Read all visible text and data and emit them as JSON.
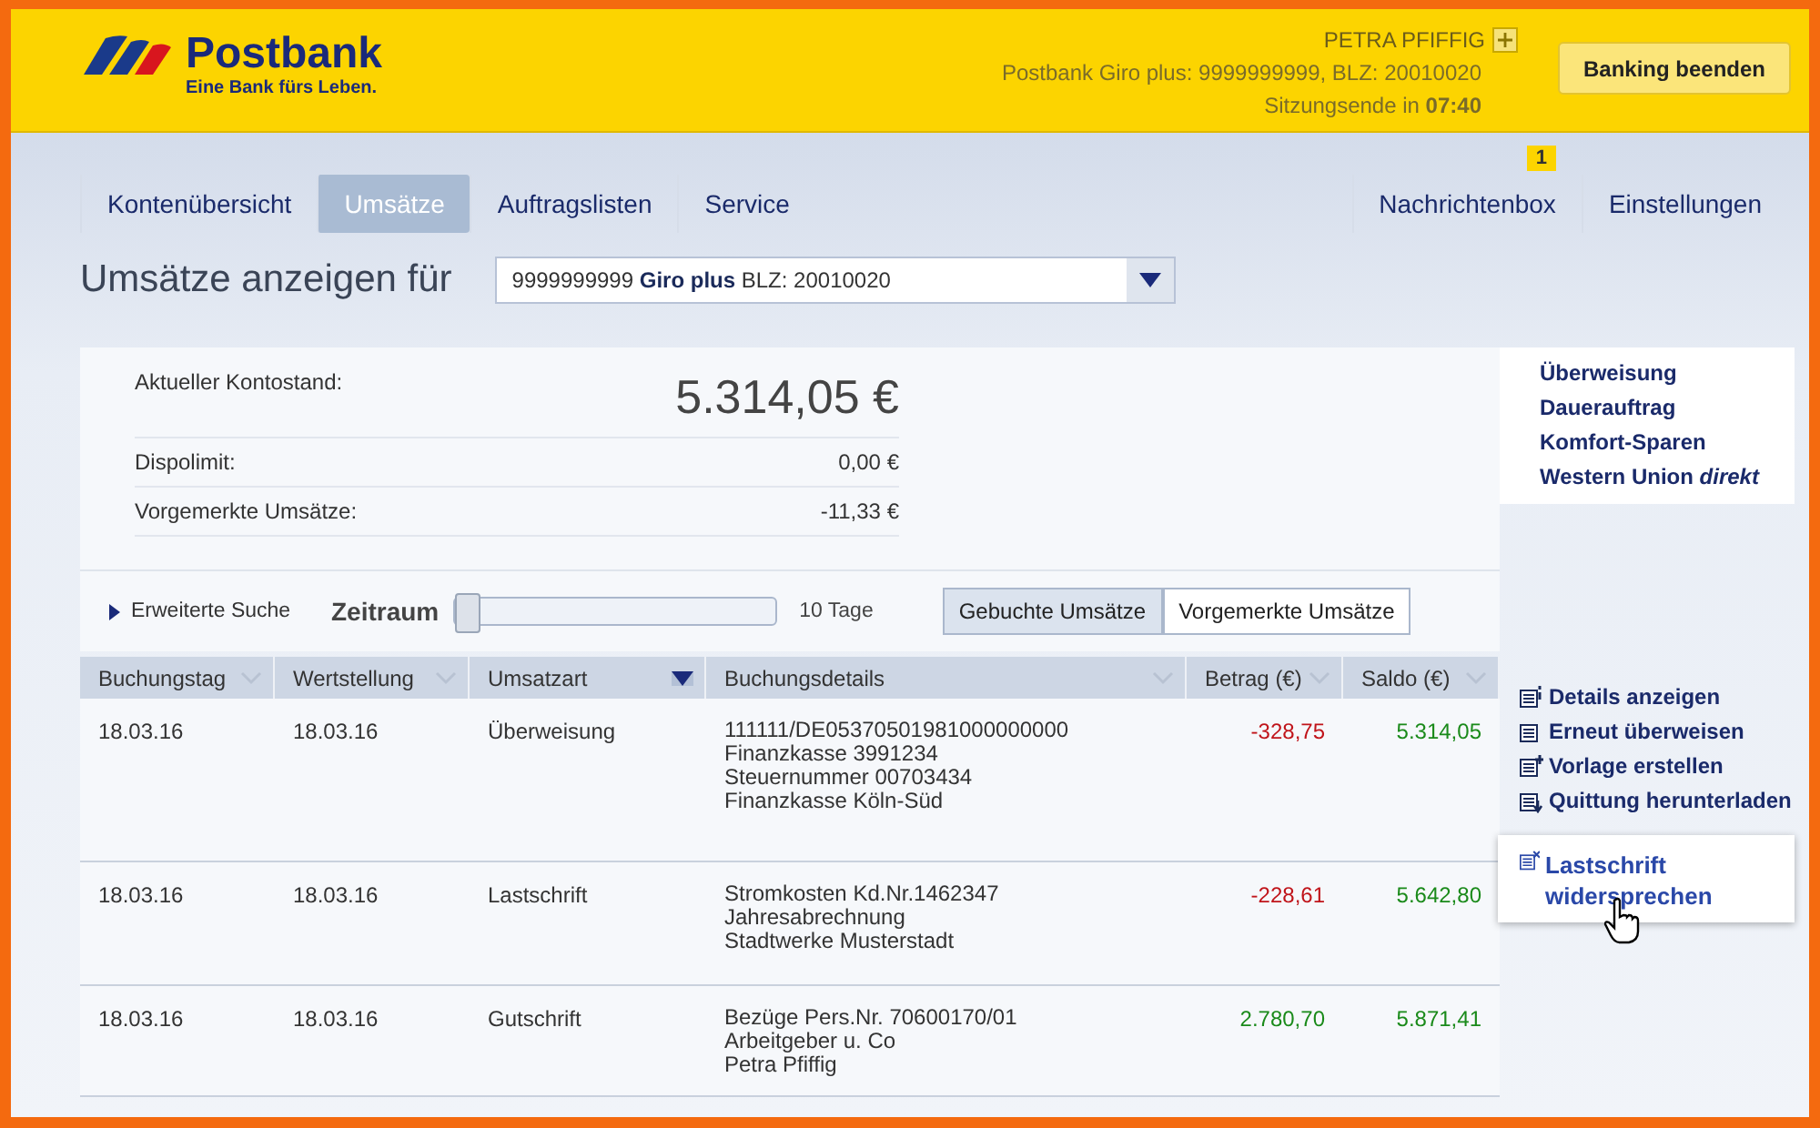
{
  "header": {
    "logo_name": "Postbank",
    "logo_tagline": "Eine Bank fürs Leben.",
    "user": "PETRA PFIFFIG",
    "account_info": "Postbank Giro plus: 9999999999, BLZ: 20010020",
    "session": "Sitzungsende in **07:40**",
    "logout_button": "Banking beenden"
  },
  "nav": {
    "left": [
      {
        "label": "Kontenübersicht",
        "selected": false
      },
      {
        "label": "Umsätze",
        "selected": true
      },
      {
        "label": "Auftragslisten",
        "selected": false
      },
      {
        "label": "Service",
        "selected": false
      }
    ],
    "right": [
      {
        "label": "Nachrichtenbox",
        "selected": false,
        "badge": "1"
      },
      {
        "label": "Einstellungen",
        "selected": false
      }
    ]
  },
  "title": "Umsätze anzeigen für",
  "account_select": "9999999999 **Giro plus** BLZ: 20010020",
  "summary": {
    "balance_label": "Aktueller Kontostand:",
    "balance": "5.314,05 €",
    "rows": [
      {
        "label": "Dispolimit:",
        "value": "0,00 €"
      },
      {
        "label": "Vorgemerkte Umsätze:",
        "value": "-11,33 €"
      }
    ]
  },
  "quick_links": [
    "Überweisung",
    "Dauerauftrag",
    "Komfort-Sparen",
    "Western Union *direkt*"
  ],
  "filter": {
    "advanced_search": "Erweiterte Suche",
    "period_label": "Zeitraum",
    "level": 0,
    "period_value": "10 Tage",
    "toggle": [
      {
        "label": "Gebuchte Umsätze",
        "selected": true
      },
      {
        "label": "Vorgemerkte Umsätze",
        "selected": false
      }
    ]
  },
  "table": {
    "columns": [
      {
        "label": "Buchungstag",
        "sorted": false
      },
      {
        "label": "Wertstellung",
        "sorted": false
      },
      {
        "label": "Umsatzart",
        "sorted": true
      },
      {
        "label": "Buchungsdetails",
        "sorted": false
      },
      {
        "label": "Betrag (€)",
        "sorted": false
      },
      {
        "label": "Saldo (€)",
        "sorted": false
      }
    ],
    "rows": [
      {
        "date": "18.03.16",
        "value_date": "18.03.16",
        "type": "Überweisung",
        "details": [
          "111111/DE05370501981000000000",
          "Finanzkasse 3991234",
          "Steuernummer 00703434",
          "Finanzkasse Köln-Süd"
        ],
        "amount": "-328,75",
        "kind": "debit",
        "balance": "5.314,05"
      },
      {
        "date": "18.03.16",
        "value_date": "18.03.16",
        "type": "Lastschrift",
        "details": [
          "Stromkosten Kd.Nr.1462347",
          "Jahresabrechnung",
          "Stadtwerke Musterstadt"
        ],
        "amount": "-228,61",
        "kind": "debit",
        "balance": "5.642,80"
      },
      {
        "date": "18.03.16",
        "value_date": "18.03.16",
        "type": "Gutschrift",
        "details": [
          "Bezüge Pers.Nr. 70600170/01",
          "Arbeitgeber u. Co",
          "Petra Pfiffig"
        ],
        "amount": "2.780,70",
        "kind": "credit",
        "balance": "5.871,41"
      }
    ]
  },
  "row_actions": [
    {
      "label": "Details anzeigen",
      "kind": "details"
    },
    {
      "label": "Erneut überweisen",
      "kind": "repeat"
    },
    {
      "label": "Vorlage erstellen",
      "kind": "template"
    },
    {
      "label": "Quittung herunterladen",
      "kind": "download"
    }
  ],
  "popup_action": {
    "label": "Lastschrift widersprechen",
    "kind": "revoke"
  }
}
